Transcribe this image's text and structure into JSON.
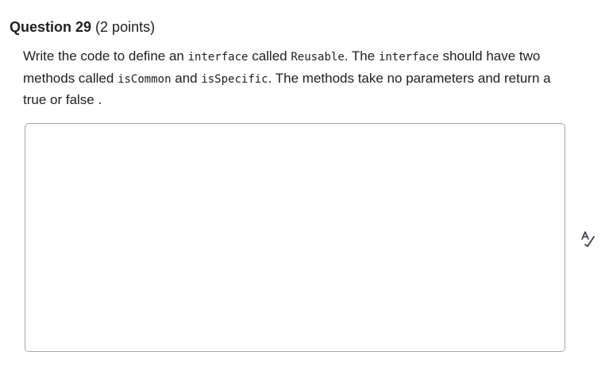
{
  "question": {
    "title": "Question 29",
    "points": "(2 points)"
  },
  "prompt": {
    "t1": "Write the code to define an ",
    "c1": "interface",
    "t2": " called ",
    "c2": "Reusable",
    "t3": ". The ",
    "c3": "interface",
    "t4": " should have two methods called ",
    "c4": "isCommon",
    "t5": " and ",
    "c5": "isSpecific",
    "t6": ". The methods take no parameters and return a true or false ."
  },
  "answer": {
    "value": "",
    "placeholder": ""
  },
  "icons": {
    "spellcheck": "spellcheck-icon"
  }
}
